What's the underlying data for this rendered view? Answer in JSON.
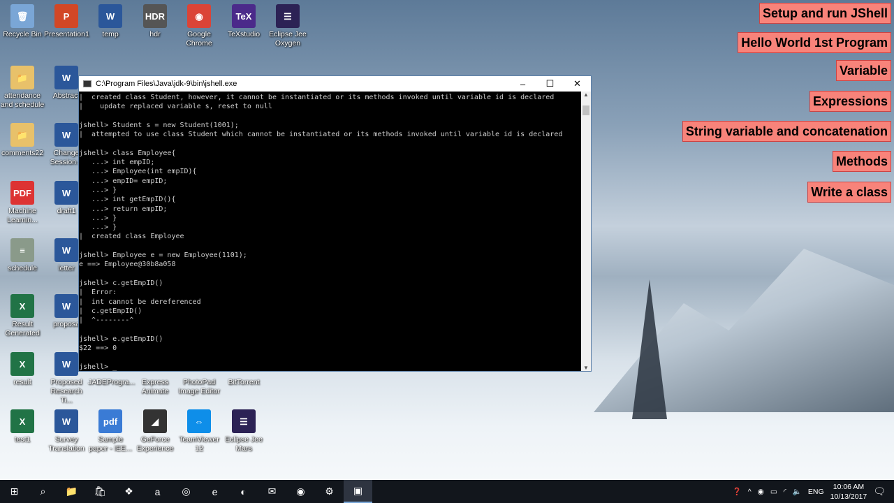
{
  "desktop_icons": [
    {
      "label": "Recycle Bin",
      "glyph": "🗑",
      "color": "#7aa6d6"
    },
    {
      "label": "Presentation1",
      "glyph": "P",
      "color": "#d24726"
    },
    {
      "label": "temp",
      "glyph": "W",
      "color": "#2b579a"
    },
    {
      "label": "hdr",
      "glyph": "HDR",
      "color": "#555"
    },
    {
      "label": "Google Chrome",
      "glyph": "◉",
      "color": "#db4437"
    },
    {
      "label": "TeXstudio",
      "glyph": "TeX",
      "color": "#4b2a8a"
    },
    {
      "label": "Eclipse Jee Oxygen",
      "glyph": "☰",
      "color": "#2c2255"
    },
    {
      "label": "attendance and schedule",
      "glyph": "📁",
      "color": "#e8c16a"
    },
    {
      "label": "Abstract",
      "glyph": "W",
      "color": "#2b579a"
    },
    {
      "label": "comments22",
      "glyph": "📁",
      "color": "#e8c16a"
    },
    {
      "label": "Change Session A",
      "glyph": "W",
      "color": "#2b579a"
    },
    {
      "label": "Machine Learnin...",
      "glyph": "PDF",
      "color": "#d33"
    },
    {
      "label": "draft1",
      "glyph": "W",
      "color": "#2b579a"
    },
    {
      "label": "schedule",
      "glyph": "≡",
      "color": "#8a9a8a"
    },
    {
      "label": "letter",
      "glyph": "W",
      "color": "#2b579a"
    },
    {
      "label": "Result Generated",
      "glyph": "X",
      "color": "#217346"
    },
    {
      "label": "proposa",
      "glyph": "W",
      "color": "#2b579a"
    },
    {
      "label": "result",
      "glyph": "X",
      "color": "#217346"
    },
    {
      "label": "Proposed Research Ti...",
      "glyph": "W",
      "color": "#2b579a"
    },
    {
      "label": "JADEProgra...",
      "glyph": "",
      "color": "transparent"
    },
    {
      "label": "Express Animate",
      "glyph": "",
      "color": "transparent"
    },
    {
      "label": "PhotoPad Image Editor",
      "glyph": "",
      "color": "transparent"
    },
    {
      "label": "BitTorrent",
      "glyph": "",
      "color": "transparent"
    },
    {
      "label": "test1",
      "glyph": "X",
      "color": "#217346"
    },
    {
      "label": "Survey Translation",
      "glyph": "W",
      "color": "#2b579a"
    },
    {
      "label": "Sample paper - IEE...",
      "glyph": "pdf",
      "color": "#3a7bd5"
    },
    {
      "label": "GeForce Experience",
      "glyph": "◢",
      "color": "#333"
    },
    {
      "label": "TeamViewer 12",
      "glyph": "⇔",
      "color": "#0e8ee9"
    },
    {
      "label": "Eclipse Jee Mars",
      "glyph": "☰",
      "color": "#2c2255"
    }
  ],
  "topics": [
    "Setup and run JShell",
    "Hello World 1st Program",
    "Variable",
    "Expressions",
    "String variable and concatenation",
    "Methods",
    "Write a class"
  ],
  "terminal": {
    "title": "C:\\Program Files\\Java\\jdk-9\\bin\\jshell.exe",
    "lines": [
      "|  created class Student, however, it cannot be instantiated or its methods invoked until variable id is declared",
      "|    update replaced variable s, reset to null",
      "",
      "jshell> Student s = new Student(1001);",
      "|  attempted to use class Student which cannot be instantiated or its methods invoked until variable id is declared",
      "",
      "jshell> class Employee{",
      "   ...> int empID;",
      "   ...> Employee(int empID){",
      "   ...> empID= empID;",
      "   ...> }",
      "   ...> int getEmpID(){",
      "   ...> return empID;",
      "   ...> }",
      "   ...> }",
      "|  created class Employee",
      "",
      "jshell> Employee e = new Employee(1101);",
      "e ==> Employee@30b8a058",
      "",
      "jshell> c.getEmpID()",
      "|  Error:",
      "|  int cannot be dereferenced",
      "|  c.getEmpID()",
      "|  ^--------^",
      "",
      "jshell> e.getEmpID()",
      "$22 ==> 0",
      "",
      "jshell> _"
    ]
  },
  "taskbar": {
    "items": [
      "⊞",
      "⌕",
      "📁",
      "🛍",
      "❖",
      "a",
      "◎",
      "e",
      "◐",
      "✉",
      "◉",
      "⚙",
      "▣"
    ],
    "lang": "ENG",
    "time": "10:06 AM",
    "date": "10/13/2017"
  }
}
